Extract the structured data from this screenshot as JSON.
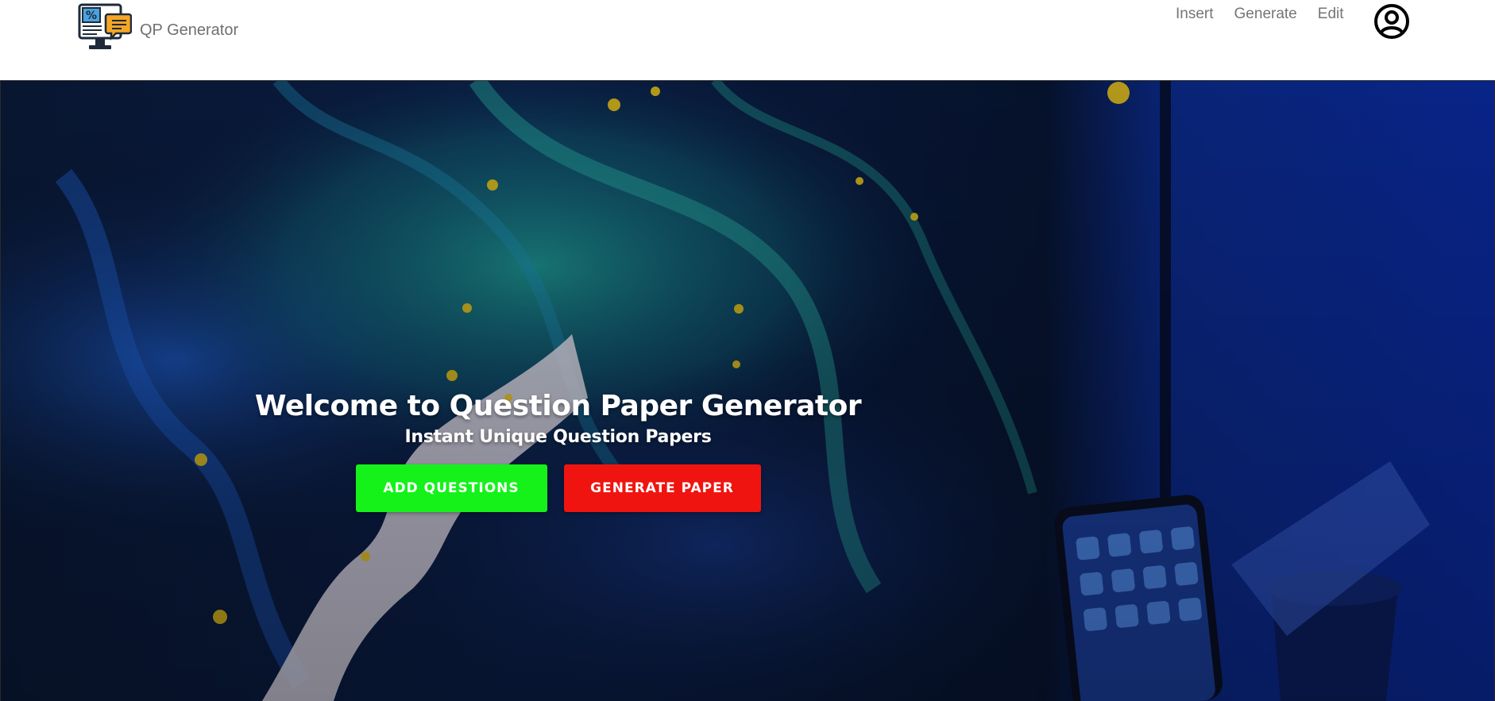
{
  "brand": {
    "name": "QP Generator",
    "logo_icon": "computer-with-chat-icon"
  },
  "nav": {
    "items": [
      {
        "label": "Insert"
      },
      {
        "label": "Generate"
      },
      {
        "label": "Edit"
      }
    ],
    "profile_icon": "user-circle-icon"
  },
  "hero": {
    "title": "Welcome to Question Paper Generator",
    "subtitle": "Instant Unique Question Papers",
    "background": "abstract-fluid-art-desk-photo",
    "buttons": {
      "add_label": "ADD QUESTIONS",
      "generate_label": "GENERATE PAPER"
    }
  },
  "colors": {
    "add_button": "#14f21a",
    "generate_button": "#f01410",
    "nav_text": "#757575"
  }
}
